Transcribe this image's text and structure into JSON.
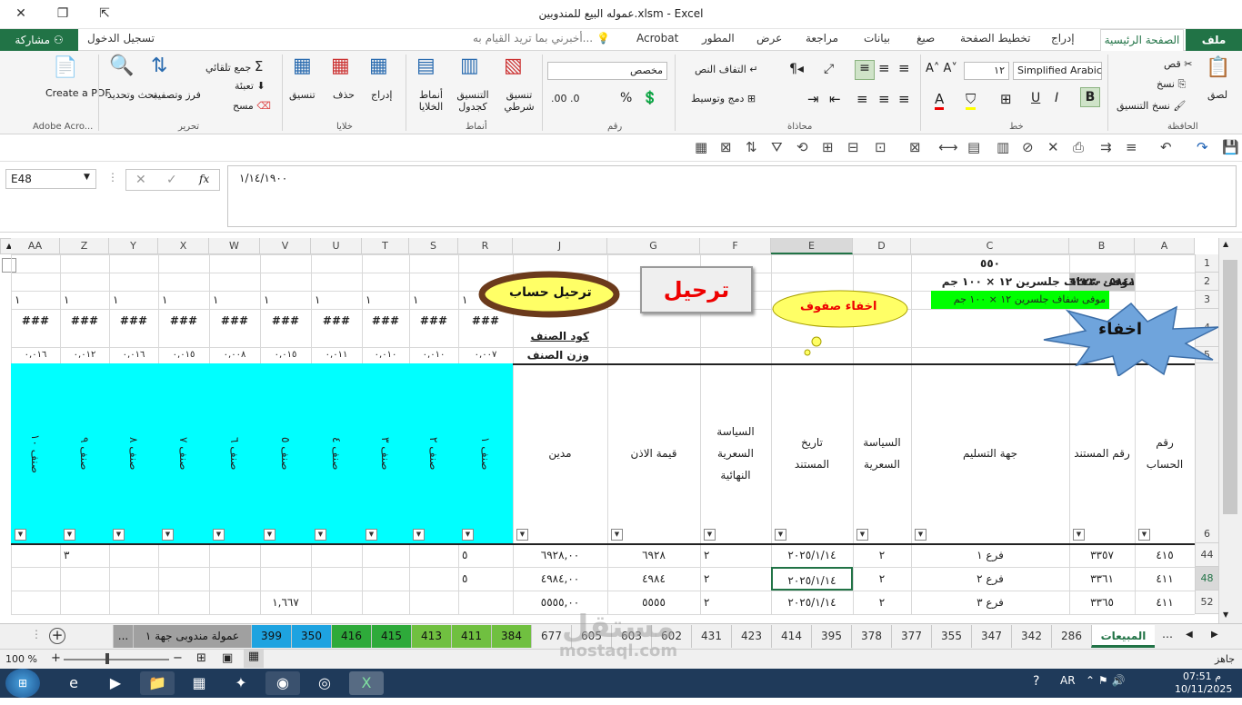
{
  "window": {
    "title": "عموله البيع للمندوبين.xlsm - Excel"
  },
  "menu": {
    "file": "ملف",
    "home": "الصفحة الرئيسية",
    "insert": "إدراج",
    "page_layout": "تخطيط الصفحة",
    "formulas": "صيغ",
    "data": "بيانات",
    "review": "مراجعة",
    "view": "عرض",
    "developer": "المطور",
    "acrobat": "Acrobat",
    "tell_me": "أخبرني بما تريد القيام به...",
    "sign_in": "تسجيل الدخول",
    "share": "مشاركة"
  },
  "ribbon": {
    "clipboard": {
      "label": "الحافظة",
      "paste": "لصق",
      "cut": "قص",
      "copy": "نسخ",
      "format_painter": "نسخ التنسيق"
    },
    "font": {
      "label": "خط",
      "font_name": "Simplified Arabic",
      "font_size": "١٢",
      "bold": "B"
    },
    "alignment": {
      "label": "محاذاة",
      "wrap": "التفاف النص",
      "merge": "دمج وتوسيط"
    },
    "number": {
      "label": "رقم",
      "format": "مخصص",
      "percent": "%"
    },
    "styles": {
      "label": "أنماط",
      "conditional": "تنسيق شرطي",
      "table": "التنسيق كجدول",
      "cell_styles": "أنماط الخلايا"
    },
    "cells": {
      "label": "خلايا",
      "insert": "إدراج",
      "delete": "حذف",
      "format": "تنسيق"
    },
    "editing": {
      "label": "تحرير",
      "autosum": "جمع تلقائي",
      "fill": "تعبئة",
      "clear": "مسح",
      "sort": "فرز وتصفية",
      "find": "بحث وتحديد"
    },
    "acrobat": {
      "label": "Adobe Acro...",
      "create_pdf": "Create a PDF"
    }
  },
  "formula": {
    "name_box": "E48",
    "fx": "fx",
    "value": "١/١٤/١٩٠٠"
  },
  "columns": [
    "A",
    "B",
    "C",
    "D",
    "E",
    "F",
    "G",
    "J",
    "R",
    "S",
    "T",
    "U",
    "V",
    "W",
    "X",
    "Y",
    "Z",
    "AA"
  ],
  "rows": [
    "1",
    "2",
    "3",
    "4",
    "5",
    "6",
    "44",
    "48",
    "52"
  ],
  "top": {
    "c1": "٥٥٠",
    "b2": "٦٢٢٣٠٠٥٨٤١٠٦٣",
    "c2": "موفى شفاف جلسرين ١٢ × ١٠٠ جم",
    "c3": "موفى شفاف جلسرين ١٢ × ١٠٠ جم",
    "j4": "كود الصنف",
    "j5": "وزن الصنف",
    "row3_ones": [
      "١",
      "١",
      "١",
      "١",
      "١",
      "١",
      "١",
      "١",
      "١",
      "١"
    ],
    "hash": "###",
    "weights": [
      "٠,٠٠٧",
      "٠,٠١٠",
      "٠,٠١٠",
      "٠,٠١١",
      "٠,٠١٥",
      "٠,٠٠٨",
      "٠,٠١٥",
      "٠,٠١٦",
      "٠,٠١٢",
      "٠,٠١٦"
    ]
  },
  "shapes": {
    "hide": "اخفاء",
    "hide_rows": "اخفاء صفوف",
    "post": "ترحيل",
    "post_account": "ترحيل حساب"
  },
  "headers": {
    "a": [
      "رقم",
      "الحساب"
    ],
    "b": [
      "رقم المستند"
    ],
    "c": [
      "جهة التسليم"
    ],
    "d": [
      "السياسة",
      "السعرية"
    ],
    "e": [
      "تاريخ",
      "المستند"
    ],
    "f": [
      "السياسة",
      "السعرية",
      "النهائية"
    ],
    "g": [
      "قيمة الاذن"
    ],
    "j": [
      "مدين"
    ],
    "items": [
      "صنف ١",
      "صنف ٢",
      "صنف ٣",
      "صنف ٤",
      "صنف ٥",
      "صنف ٦",
      "صنف ٧",
      "صنف ٨",
      "صنف ٩",
      "صنف ١٠"
    ]
  },
  "data_rows": [
    {
      "a": "٤١٥",
      "b": "٣٣٥٧",
      "c": "فرع ١",
      "d": "٢",
      "e": "٢٠٢٥/١/١٤",
      "f": "٢",
      "g": "٦٩٢٨",
      "j": "٦٩٢٨,٠٠",
      "r": "٥",
      "v": "",
      "z": "٣"
    },
    {
      "a": "٤١١",
      "b": "٣٣٦١",
      "c": "فرع ٢",
      "d": "٢",
      "e": "٢٠٢٥/١/١٤",
      "f": "٢",
      "g": "٤٩٨٤",
      "j": "٤٩٨٤,٠٠",
      "r": "٥",
      "v": "",
      "z": ""
    },
    {
      "a": "٤١١",
      "b": "٣٣٦٥",
      "c": "فرع ٣",
      "d": "٢",
      "e": "٢٠٢٥/١/١٤",
      "f": "٢",
      "g": "٥٥٥٥",
      "j": "٥٥٥٥,٠٠",
      "r": "",
      "v": "١,٦٦٧",
      "z": ""
    }
  ],
  "sheet_tabs": [
    "المبيعات",
    "286",
    "342",
    "347",
    "355",
    "377",
    "378",
    "395",
    "414",
    "423",
    "431",
    "602",
    "603",
    "605",
    "677",
    "384",
    "411",
    "413",
    "415",
    "416",
    "350",
    "399",
    "عمولة مندوبى جهة ١",
    "..."
  ],
  "status": {
    "ready": "جاهز",
    "zoom": "100 %"
  },
  "taskbar": {
    "time": "07:51 م",
    "date": "10/11/2025"
  },
  "watermark": {
    "main": "مستقل",
    "sub": "mostaql.com"
  }
}
